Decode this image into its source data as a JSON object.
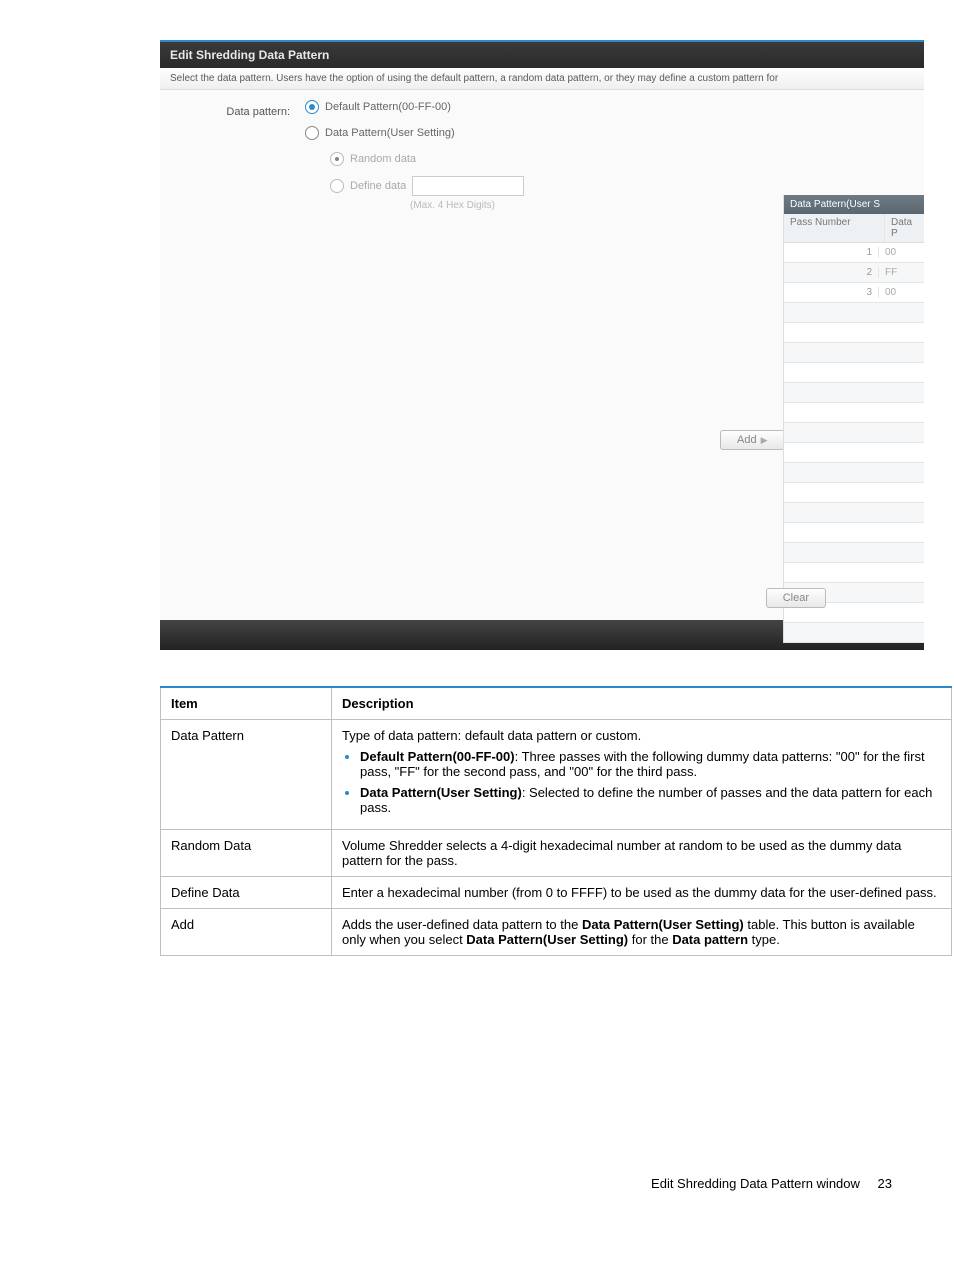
{
  "screenshot": {
    "title": "Edit Shredding Data Pattern",
    "instruction": "Select the data pattern. Users have the option of using the default pattern, a random data pattern, or they may define a custom pattern for",
    "left_label": "Data pattern:",
    "radio_default": "Default Pattern(00-FF-00)",
    "radio_user": "Data Pattern(User Setting)",
    "sub_random": "Random data",
    "sub_define": "Define data",
    "hint": "(Max. 4 Hex Digits)",
    "add_label": "Add",
    "clear_label": "Clear",
    "right_table": {
      "header": "Data Pattern(User S",
      "col1": "Pass Number",
      "col2": "Data P",
      "rows": [
        {
          "n": "1",
          "v": "00"
        },
        {
          "n": "2",
          "v": "FF"
        },
        {
          "n": "3",
          "v": "00"
        }
      ]
    }
  },
  "doc": {
    "headers": {
      "item": "Item",
      "desc": "Description"
    },
    "rows": {
      "data_pattern": {
        "item": "Data Pattern",
        "intro": "Type of data pattern: default data pattern or custom.",
        "b1_strong": "Default Pattern(00-FF-00)",
        "b1_rest": ": Three passes with the following dummy data patterns: \"00\" for the first pass, \"FF\" for the second pass, and \"00\" for the third pass.",
        "b2_strong": "Data Pattern(User Setting)",
        "b2_rest": ": Selected to define the number of passes and the data pattern for each pass."
      },
      "random": {
        "item": "Random Data",
        "desc": "Volume Shredder selects a 4-digit hexadecimal number at random to be used as the dummy data pattern for the pass."
      },
      "define": {
        "item": "Define Data",
        "desc": "Enter a hexadecimal number (from 0 to FFFF) to be used as the dummy data for the user-defined pass."
      },
      "add": {
        "item": "Add",
        "pre": "Adds the user-defined data pattern to the ",
        "s1": "Data Pattern(User Setting)",
        "mid": " table. This button is available only when you select ",
        "s2": "Data Pattern(User Setting)",
        "mid2": " for the ",
        "s3": "Data pattern",
        "post": " type."
      }
    }
  },
  "footer": {
    "title": "Edit Shredding Data Pattern window",
    "page": "23"
  }
}
